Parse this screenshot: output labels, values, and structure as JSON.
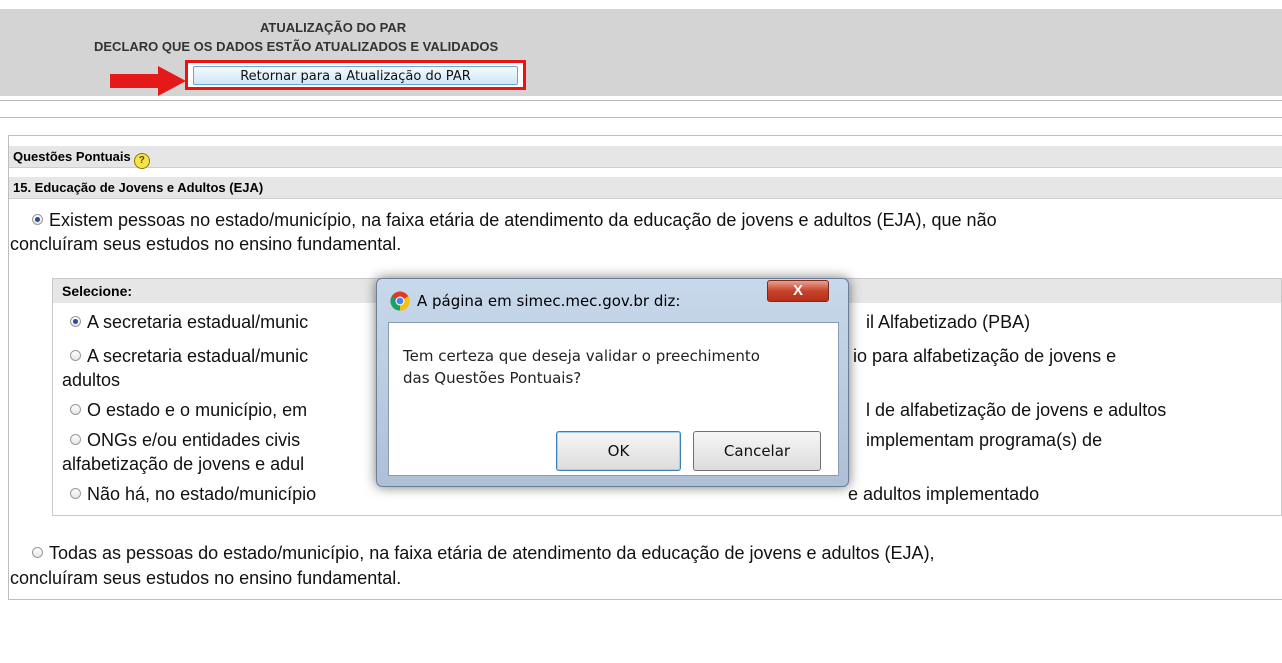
{
  "header": {
    "title_line1": "ATUALIZAÇÃO DO PAR",
    "title_line2": "DECLARO QUE OS DADOS ESTÃO ATUALIZADOS E VALIDADOS",
    "return_button": "Retornar para a Atualização do PAR"
  },
  "section": {
    "title": "Questões Pontuais",
    "question": "15. Educação de Jovens e Adultos (EJA)",
    "option_a_line1": "Existem pessoas no estado/município, na faixa etária de atendimento da educação de jovens e adultos (EJA), que não",
    "option_a_line2": "concluíram seus estudos no ensino fundamental.",
    "option_b_line1": "Todas as pessoas do estado/município, na faixa etária de atendimento da educação de jovens e adultos (EJA),",
    "option_b_line2": "concluíram seus estudos no ensino fundamental."
  },
  "select": {
    "label": "Selecione:",
    "options": [
      {
        "left": "A secretaria estadual/munic",
        "right": "il Alfabetizado (PBA)"
      },
      {
        "left": "A secretaria estadual/munic",
        "right": "io para alfabetização de jovens e",
        "line2": "adultos"
      },
      {
        "left": "O estado e o município, em",
        "right": "l de alfabetização de jovens e adultos"
      },
      {
        "left": "ONGs e/ou entidades civis",
        "right": "implementam programa(s) de",
        "line2": "alfabetização de jovens e adul"
      },
      {
        "left": "Não há, no estado/município",
        "right": "e adultos implementado"
      }
    ]
  },
  "dialog": {
    "title": "A página em simec.mec.gov.br diz:",
    "close": "X",
    "message_line1": "Tem certeza que deseja validar o preechimento",
    "message_line2": "das Questões Pontuais?",
    "ok": "OK",
    "cancel": "Cancelar"
  },
  "colors": {
    "highlight_red": "#ee1111",
    "dialog_close": "#c7432b"
  }
}
